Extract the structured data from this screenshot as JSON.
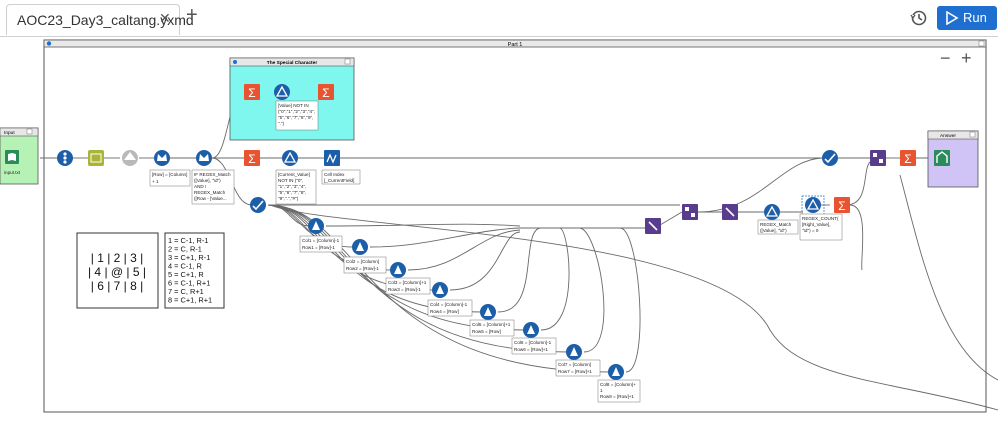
{
  "tab": {
    "title": "AOC23_Day3_caltang.yxmd",
    "close": "✕",
    "add": "+"
  },
  "toolbar": {
    "run_label": "Run"
  },
  "zoom": {
    "minus": "−",
    "plus": "+"
  },
  "container_part1": {
    "title": "Part 1"
  },
  "container_special": {
    "title": "The Special Character"
  },
  "container_input": {
    "title": "Input"
  },
  "container_answer": {
    "title": "Answer"
  },
  "input_tool": {
    "label": "input.txt"
  },
  "labels": {
    "special_filter": [
      "[Value] NOT IN",
      "(\"0\",\"1\",\"2\",\"3\",\"4\",",
      "\"5\",\"6\",\"7\",\"8\",\"9\",",
      "\".\")"
    ],
    "row_formula": [
      "[Row] = [Column]",
      "+ 1"
    ],
    "regex_formula": [
      "IF REGEX_Match",
      "([Value], \"\\d\")",
      "AND !",
      "REGEX_Match",
      "([Row - [Value..."
    ],
    "symbol_filter": [
      "[Current_Value]",
      "NOT IN (\"0\",",
      "\"1\",\"2\",\"3\",\"4\",",
      "\"5\",\"6\",\"7\",\"8\",",
      "\"9\",\".\",\"#\")"
    ],
    "cell_index": [
      "Cell Index",
      "[_CurrentField]"
    ],
    "regex_match_right": [
      "REGEX_Match",
      "([Value], \"\\d\")"
    ],
    "regex_count": [
      "REGEX_COUNT(",
      "[Right_Value],",
      "\"\\d\") = 0"
    ],
    "neighbor1": [
      "Col1 = [Column]-1",
      "Row1 = [Row]-1"
    ],
    "neighbor2": [
      "Col2 = [Column]",
      "Row2 = [Row]-1"
    ],
    "neighbor3": [
      "Col3 = [Column]+1",
      "Row3 = [Row]-1"
    ],
    "neighbor4": [
      "Col4 = [Column]-1",
      "Row4 = [Row]"
    ],
    "neighbor5": [
      "Col5 = [Column]+1",
      "Row5 = [Row]"
    ],
    "neighbor6": [
      "Col6 = [Column]-1",
      "Row6 = [Row]+1"
    ],
    "neighbor7": [
      "Col7 = [Column]",
      "Row7 = [Row]+1"
    ],
    "neighbor8": [
      "Col8 = [Column]+",
      "1",
      "Row8 = [Row]+1"
    ]
  },
  "grid_comment": {
    "lines": [
      "| 1 |  2  | 3 |",
      "| 4 | @ | 5 |",
      "| 6 |  7  | 8 |"
    ]
  },
  "mapping_comment": {
    "lines": [
      "1 = C-1, R-1",
      "2 = C, R-1",
      "3 = C+1, R-1",
      "4 = C-1, R",
      "5 = C+1, R",
      "6 = C-1, R+1",
      "7 = C, R+1",
      "8 = C+1, R+1"
    ]
  },
  "colors": {
    "accent": "#1f6fd1",
    "special_bg": "#7ff7ef",
    "answer_bg": "#cfc4f5",
    "input_bg": "#b6f2b5",
    "summarize": "#e8542f",
    "tool_blue": "#1d5ea8",
    "connector": "#6a6a6a"
  }
}
